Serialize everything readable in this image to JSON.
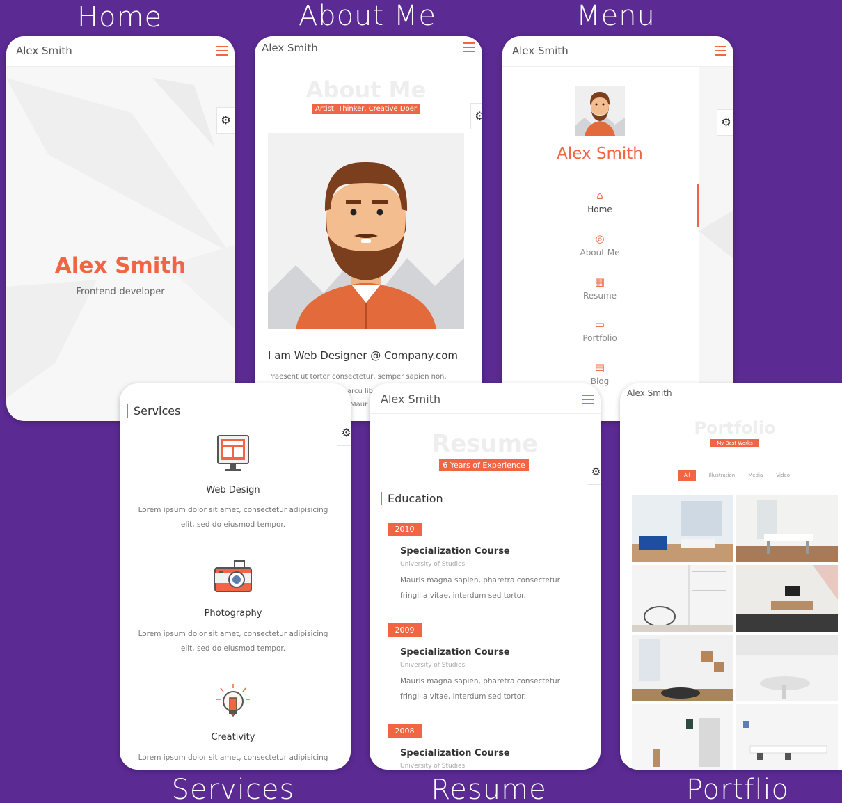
{
  "captions": {
    "home": "Home",
    "about": "About Me",
    "menu": "Menu",
    "services": "Services",
    "resume": "Resume",
    "portfolio": "Portflio"
  },
  "colors": {
    "accent": "#f06543",
    "background": "#5b2a93"
  },
  "app_name": "Alex Smith",
  "home": {
    "name": "Alex Smith",
    "role": "Frontend-developer"
  },
  "about": {
    "ghost_title": "About Me",
    "tagline": "Artist, Thinker, Creative Doer",
    "headline": "I am Web Designer @ Company.com",
    "paragraph": "Praesent ut tortor consectetur, semper sapien non,",
    "paragraph_frag1": "arcu lib",
    "paragraph_frag2": "Maur"
  },
  "menu": {
    "name": "Alex Smith",
    "items": [
      {
        "label": "Home",
        "icon": "home-icon",
        "active": true
      },
      {
        "label": "About Me",
        "icon": "user-icon",
        "active": false
      },
      {
        "label": "Resume",
        "icon": "calendar-icon",
        "active": false
      },
      {
        "label": "Portfolio",
        "icon": "briefcase-icon",
        "active": false
      },
      {
        "label": "Blog",
        "icon": "document-icon",
        "active": false
      }
    ]
  },
  "services": {
    "title": "Services",
    "items": [
      {
        "name": "Web Design",
        "icon": "monitor-icon",
        "text1": "Lorem ipsum dolor sit amet, consectetur adipisicing",
        "text2": "elit, sed do eiusmod tempor."
      },
      {
        "name": "Photography",
        "icon": "camera-icon",
        "text1": "Lorem ipsum dolor sit amet, consectetur adipisicing",
        "text2": "elit, sed do eiusmod tempor."
      },
      {
        "name": "Creativity",
        "icon": "lightbulb-pencil-icon",
        "text1": "Lorem ipsum dolor sit amet, consectetur adipisicing",
        "text2": ""
      }
    ]
  },
  "resume": {
    "ghost_title": "Resume",
    "tagline": "6 Years of Experience",
    "section": "Education",
    "entries": [
      {
        "year": "2010",
        "course": "Specialization Course",
        "uni": "University of Studies",
        "desc1": "Mauris magna sapien, pharetra consectetur",
        "desc2": "fringilla vitae, interdum sed tortor."
      },
      {
        "year": "2009",
        "course": "Specialization Course",
        "uni": "University of Studies",
        "desc1": "Mauris magna sapien, pharetra consectetur",
        "desc2": "fringilla vitae, interdum sed tortor."
      },
      {
        "year": "2008",
        "course": "Specialization Course",
        "uni": "University of Studies",
        "desc1": "",
        "desc2": ""
      }
    ]
  },
  "portfolio": {
    "ghost_title": "Portfolio",
    "tagline": "My Best Works",
    "filters": [
      "All",
      "Illustration",
      "Media",
      "Video"
    ]
  }
}
